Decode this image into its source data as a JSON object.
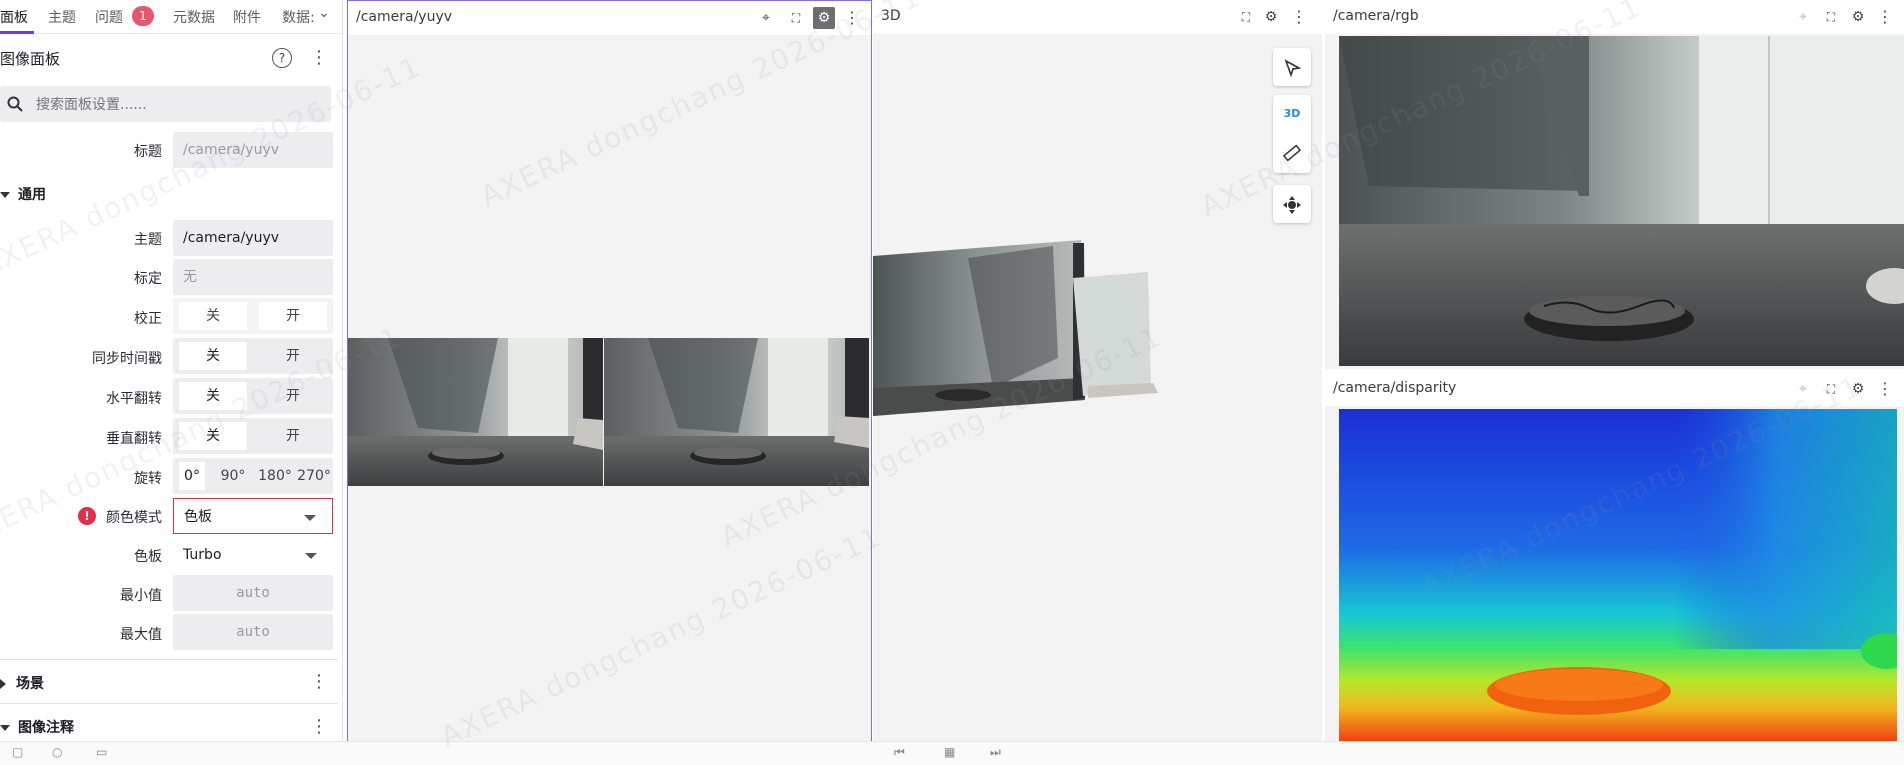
{
  "sidebar": {
    "tabs": [
      {
        "label": "面板"
      },
      {
        "label": "主题"
      },
      {
        "label": "问题",
        "badge": "1"
      },
      {
        "label": "元数据"
      },
      {
        "label": "附件"
      },
      {
        "label": "数据:"
      }
    ],
    "panel_title": "图像面板",
    "help_icon": "?",
    "search_placeholder": "搜索面板设置......",
    "title_label": "标题",
    "title_value": "/camera/yuyv",
    "general_section": "通用",
    "rows": {
      "topic": {
        "label": "主题",
        "value": "/camera/yuyv"
      },
      "calibration": {
        "label": "标定",
        "value": "无"
      },
      "rectify": {
        "label": "校正",
        "off": "关",
        "on": "开",
        "selected": "off"
      },
      "sync_timestamp": {
        "label": "同步时间戳",
        "off": "关",
        "on": "开"
      },
      "flip_h": {
        "label": "水平翻转",
        "off": "关",
        "on": "开"
      },
      "flip_v": {
        "label": "垂直翻转",
        "off": "关",
        "on": "开"
      },
      "rotation": {
        "label": "旋转",
        "options": [
          "0°",
          "90°",
          "180°",
          "270°"
        ],
        "selected": "0°"
      },
      "color_mode": {
        "label": "颜色模式",
        "value": "色板",
        "error_icon": "!"
      },
      "palette": {
        "label": "色板",
        "value": "Turbo"
      },
      "min": {
        "label": "最小值",
        "placeholder": "auto"
      },
      "max": {
        "label": "最大值",
        "placeholder": "auto"
      }
    },
    "scene_section": "场景",
    "annotations_section": "图像注释"
  },
  "panels": {
    "yuyv": {
      "title": "/camera/yuyv"
    },
    "three_d": {
      "title": "3D",
      "mode_label": "3D"
    },
    "rgb": {
      "title": "/camera/rgb"
    },
    "disparity": {
      "title": "/camera/disparity"
    }
  },
  "watermark": "AXERA  dongchang  2026-06-11",
  "colors": {
    "accent": "#6f3be8",
    "error": "#e02f48",
    "badge": "#e5566f",
    "panel_bg": "#f3f3f3"
  }
}
